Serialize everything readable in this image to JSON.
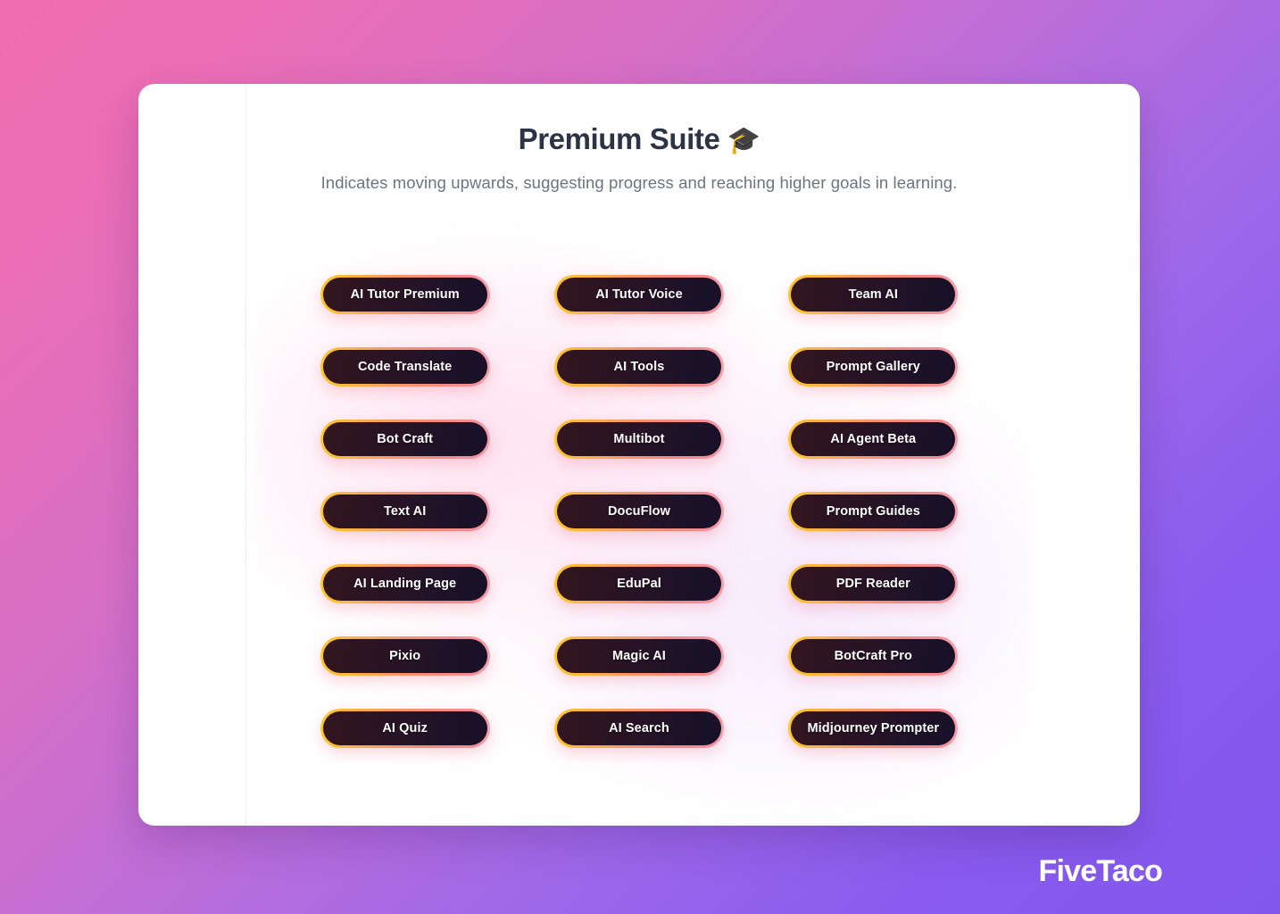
{
  "header": {
    "title": "Premium Suite",
    "title_icon": "graduation-cap-icon",
    "title_emoji": "🎓",
    "subtitle": "Indicates moving upwards, suggesting progress and reaching higher goals in learning."
  },
  "grid": {
    "columns": 3,
    "rows": 7,
    "items": [
      {
        "label": "AI Tutor Premium"
      },
      {
        "label": "AI Tutor Voice"
      },
      {
        "label": "Team AI"
      },
      {
        "label": "Code Translate"
      },
      {
        "label": "AI Tools"
      },
      {
        "label": "Prompt Gallery"
      },
      {
        "label": "Bot Craft"
      },
      {
        "label": "Multibot"
      },
      {
        "label": "AI Agent Beta"
      },
      {
        "label": "Text AI"
      },
      {
        "label": "DocuFlow"
      },
      {
        "label": "Prompt Guides"
      },
      {
        "label": "AI Landing Page"
      },
      {
        "label": "EduPal"
      },
      {
        "label": "PDF Reader"
      },
      {
        "label": "Pixio"
      },
      {
        "label": "Magic AI"
      },
      {
        "label": "BotCraft Pro"
      },
      {
        "label": "AI Quiz"
      },
      {
        "label": "AI Search"
      },
      {
        "label": "Midjourney Prompter"
      }
    ]
  },
  "brand": {
    "name": "FiveTaco"
  },
  "colors": {
    "background_gradient_start": "#ef6db2",
    "background_gradient_end": "#8257ee",
    "card_background": "#ffffff",
    "title_text": "#2b3344",
    "subtitle_text": "#6d7480",
    "pill_border_gradient_start": "#fec626",
    "pill_border_gradient_end": "#f4a0ad",
    "pill_fill_start": "#33161f",
    "pill_fill_end": "#181128",
    "pill_label_text": "#ffffff",
    "brand_text": "#ffffff"
  }
}
